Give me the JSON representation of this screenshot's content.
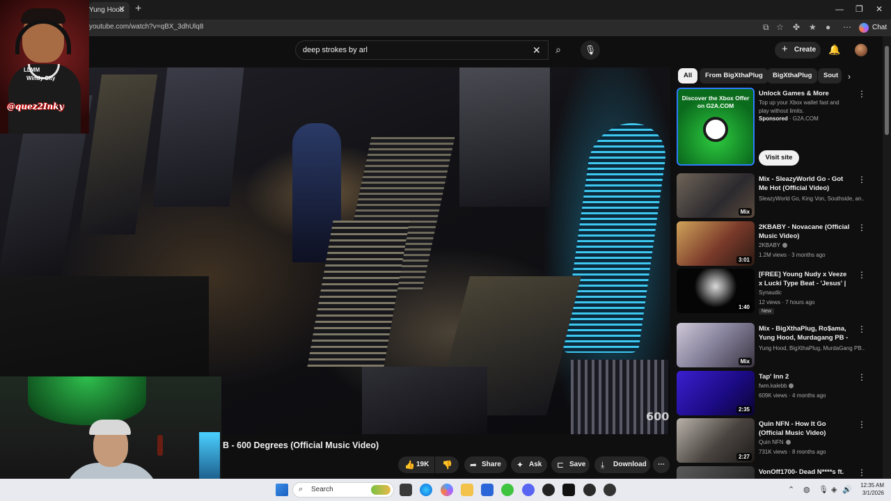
{
  "browser": {
    "tab_title": "Yung Hood",
    "url": "youtube.com/watch?v=qBX_3dhUlq8",
    "chat_label": "Chat"
  },
  "header": {
    "search_query": "deep strokes by arl",
    "create_label": "Create"
  },
  "video": {
    "title": "B - 600 Degrees (Official Music Video)",
    "watermark": "600"
  },
  "overlay": {
    "brand_line1": "LLMM",
    "brand_line2": "Windy City",
    "tag": "@quez2Inky"
  },
  "actions": {
    "likes": "19K",
    "share": "Share",
    "ask": "Ask",
    "save": "Save",
    "download": "Download"
  },
  "chips": [
    "All",
    "From BigXthaPlug",
    "BigXthaPlug",
    "Sout"
  ],
  "ad": {
    "thumb_text": "Discover the Xbox Offer on G2A.COM",
    "title": "Unlock Games & More",
    "description": "Top up your Xbox wallet fast and play without limits.",
    "sponsored": "Sponsored",
    "domain": "G2A.COM",
    "cta": "Visit site"
  },
  "recommendations": [
    {
      "title": "Mix - SleazyWorld Go - Got Me Hot (Official Video)",
      "channel": "SleazyWorld Go, King Von, Southside, an...",
      "meta": "",
      "duration": "Mix"
    },
    {
      "title": "2KBABY - Novacane (Official Music Video)",
      "channel": "2KBABY",
      "meta": "1.2M views · 3 months ago",
      "duration": "3:01"
    },
    {
      "title": "[FREE] Young Nudy x Veeze x Lucki Type Beat - 'Jesus' | ...",
      "channel": "Synaudic",
      "meta": "12 views · 7 hours ago",
      "duration": "1:40",
      "badge": "New"
    },
    {
      "title": "Mix - BigXthaPlug, Ro$ama, Yung Hood, Murdagang PB - ...",
      "channel": "Yung Hood, BigXthaPlug, MurdaGang PB...",
      "meta": "",
      "duration": "Mix"
    },
    {
      "title": "Tap' Inn 2",
      "channel": "fwm.kalebb",
      "meta": "609K views · 4 months ago",
      "duration": "2:35"
    },
    {
      "title": "Quin NFN - How It Go (Official Music Video)",
      "channel": "Quin NFN",
      "meta": "731K views · 8 months ago",
      "duration": "2:27"
    },
    {
      "title": "VonOff1700- Dead N****s ft.",
      "channel": "",
      "meta": "",
      "duration": ""
    }
  ],
  "taskbar": {
    "search_label": "Search",
    "time": "12:35 AM",
    "date": "3/1/2026"
  }
}
